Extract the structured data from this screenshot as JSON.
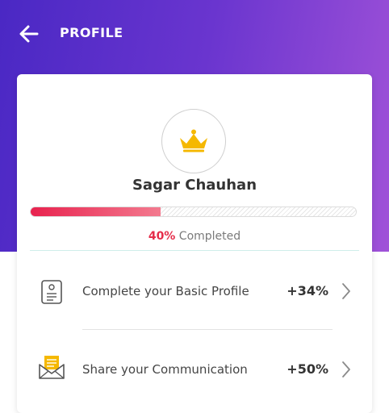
{
  "header": {
    "title": "PROFILE",
    "back_icon": "arrow-left-icon"
  },
  "profile": {
    "avatar_icon": "crown-icon",
    "name": "Sagar Chauhan",
    "progress_percent": 40,
    "progress_percent_label": "40%",
    "progress_suffix": " Completed"
  },
  "tasks": [
    {
      "icon": "document-icon",
      "label": "Complete your Basic Profile",
      "bonus": "+34%",
      "chevron": "chevron-right-icon"
    },
    {
      "icon": "envelope-icon",
      "label": "Share your Communication",
      "bonus": "+50%",
      "chevron": "chevron-right-icon"
    }
  ],
  "colors": {
    "header_gradient_start": "#4a28c4",
    "header_gradient_end": "#a052d8",
    "progress_start": "#e8224e",
    "progress_end": "#f37a8f",
    "crown": "#f5b800",
    "envelope": "#f5b800"
  }
}
